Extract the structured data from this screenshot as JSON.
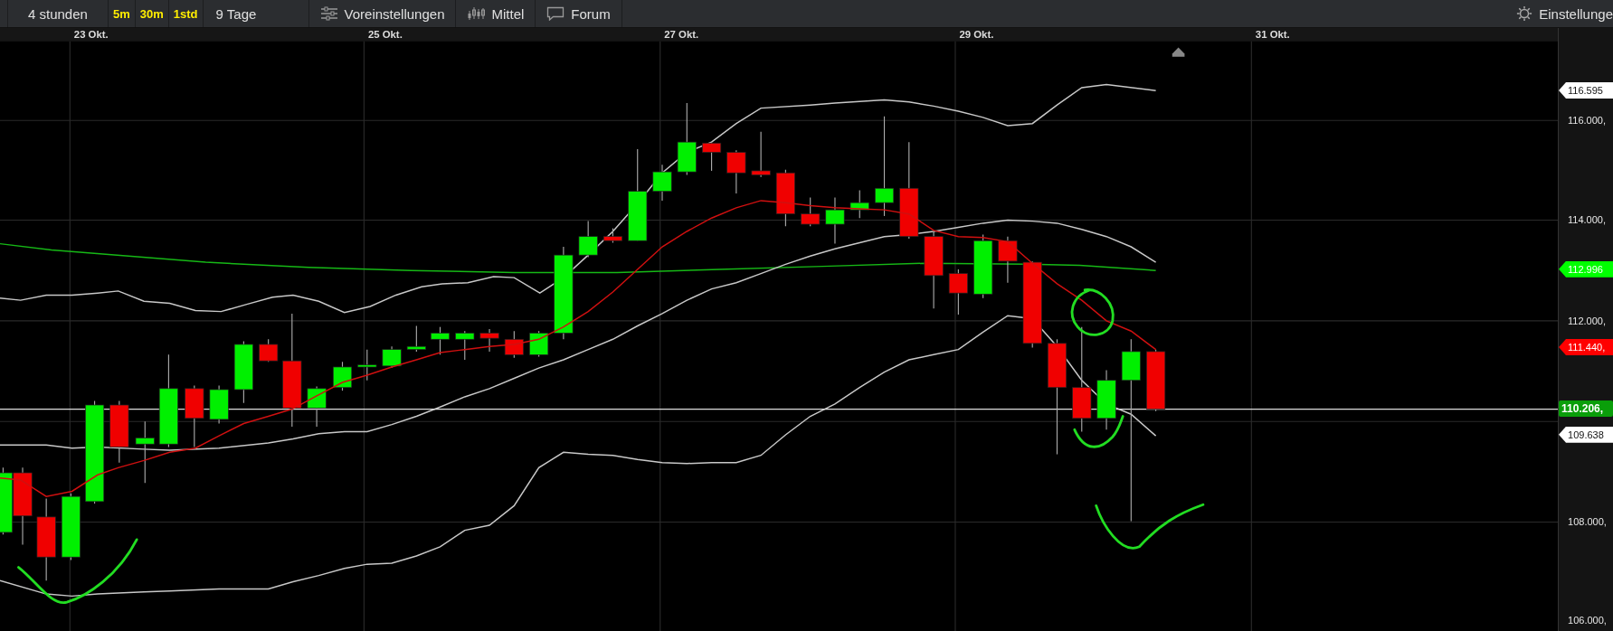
{
  "toolbar": {
    "range": "4 stunden",
    "intervals": [
      "5m",
      "30m",
      "1std"
    ],
    "period": "9 Tage",
    "buttons": [
      {
        "kind": "presets",
        "label": "Voreinstellungen"
      },
      {
        "kind": "chart-type",
        "label": "Mittel"
      },
      {
        "kind": "forum",
        "label": "Forum"
      }
    ],
    "settings": "Einstellunge"
  },
  "date_axis": [
    "23 Okt.",
    "25 Okt.",
    "27 Okt.",
    "29 Okt.",
    "31 Okt."
  ],
  "price_axis": [
    "116.000,",
    "114.000,",
    "112.000,",
    "108.000,",
    "106.000,"
  ],
  "price_tags": [
    {
      "kind": "indicator",
      "text": "116.595",
      "color": "#ffffff"
    },
    {
      "kind": "indicator",
      "text": "112.996",
      "color": "#00ff00"
    },
    {
      "kind": "indicator",
      "text": "111.440,",
      "color": "#ff0000"
    },
    {
      "kind": "last",
      "text": "110.206,",
      "color": "#0a9e0a"
    },
    {
      "kind": "indicator",
      "text": "109.638",
      "color": "#ffffff"
    }
  ]
}
